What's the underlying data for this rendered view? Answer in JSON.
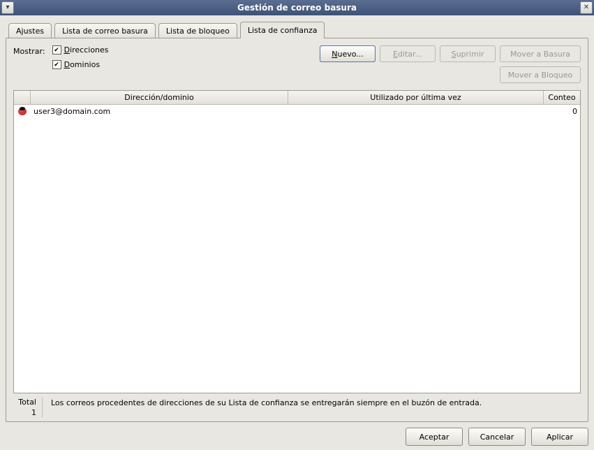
{
  "window": {
    "title": "Gestión de correo basura"
  },
  "tabs": [
    {
      "id": "ajustes",
      "label": "Ajustes",
      "active": false
    },
    {
      "id": "basura",
      "label": "Lista de correo basura",
      "active": false
    },
    {
      "id": "bloqueo",
      "label": "Lista de bloqueo",
      "active": false
    },
    {
      "id": "confianza",
      "label": "Lista de confianza",
      "active": true
    }
  ],
  "show": {
    "label": "Mostrar:",
    "direcciones": {
      "label_pre": "D",
      "label_rest": "irecciones",
      "checked": true
    },
    "dominios": {
      "label_pre": "D",
      "label_rest": "ominios",
      "checked": true
    }
  },
  "toolbar": {
    "nuevo": {
      "pre": "N",
      "rest": "uevo...",
      "enabled": true,
      "focused": true
    },
    "editar": {
      "pre": "E",
      "rest": "ditar...",
      "enabled": false,
      "focused": false
    },
    "suprimir": {
      "pre": "S",
      "rest": "uprimir",
      "enabled": false,
      "focused": false
    },
    "mover_basura": {
      "label": "Mover a Basura",
      "enabled": false
    },
    "mover_bloqueo": {
      "label": "Mover a Bloqueo",
      "enabled": false
    }
  },
  "columns": {
    "icon": "",
    "addr": "Dirección/dominio",
    "last": "Utilizado por última vez",
    "count": "Conteo"
  },
  "rows": [
    {
      "addr": "user3@domain.com",
      "last": "",
      "count": "0"
    }
  ],
  "totals": {
    "label": "Total",
    "value": "1"
  },
  "hint": "Los correos procedentes de direcciones de su Lista de confianza se entregarán siempre en el buzón de entrada.",
  "dialog_buttons": {
    "aceptar": "Aceptar",
    "cancelar": "Cancelar",
    "aplicar": "Aplicar"
  }
}
